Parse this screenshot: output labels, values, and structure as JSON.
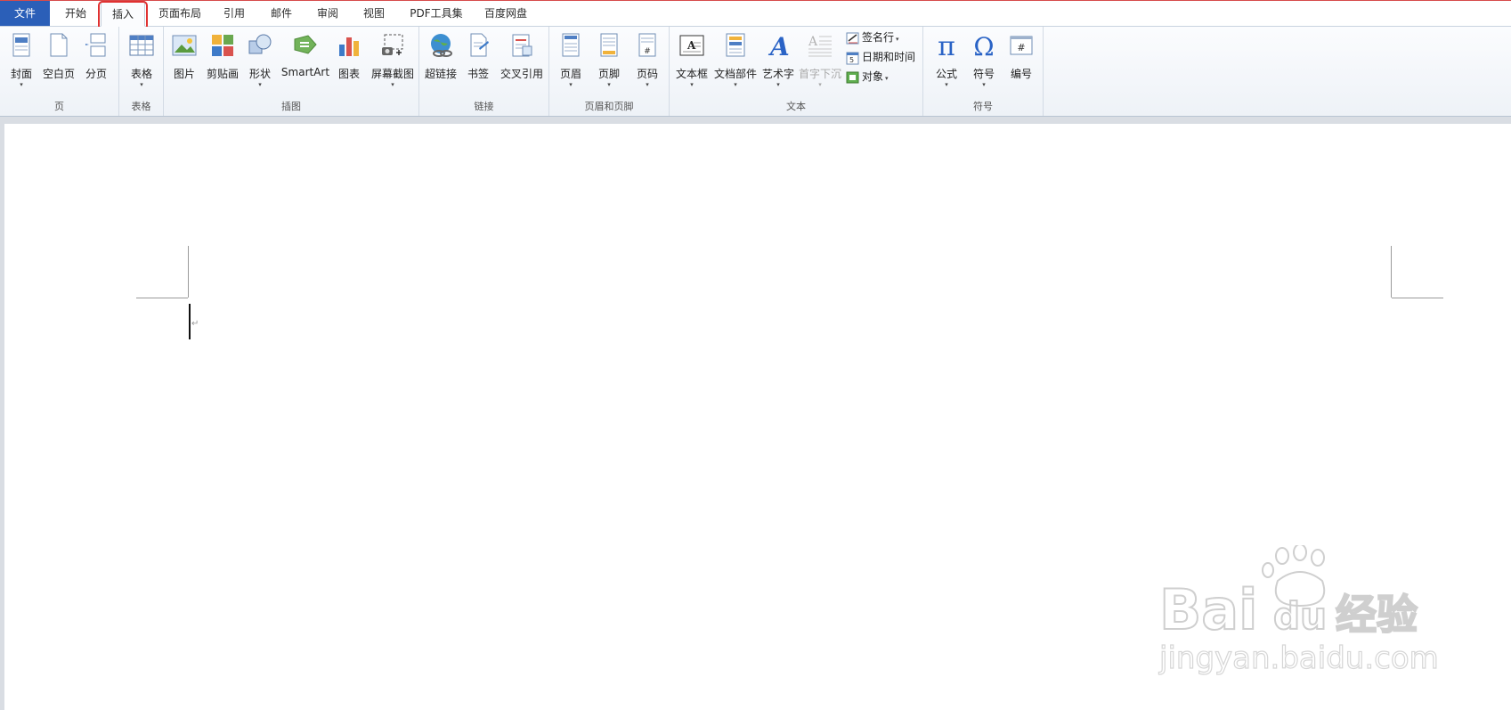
{
  "tabs": [
    "文件",
    "开始",
    "插入",
    "页面布局",
    "引用",
    "邮件",
    "审阅",
    "视图",
    "PDF工具集",
    "百度网盘"
  ],
  "groups": {
    "page": {
      "label": "页",
      "buttons": [
        "封面",
        "空白页",
        "分页"
      ]
    },
    "table": {
      "label": "表格",
      "buttons": [
        "表格"
      ]
    },
    "illustrations": {
      "label": "插图",
      "buttons": [
        "图片",
        "剪贴画",
        "形状",
        "SmartArt",
        "图表",
        "屏幕截图"
      ]
    },
    "links": {
      "label": "链接",
      "buttons": [
        "超链接",
        "书签",
        "交叉引用"
      ]
    },
    "header_footer": {
      "label": "页眉和页脚",
      "buttons": [
        "页眉",
        "页脚",
        "页码"
      ]
    },
    "text": {
      "label": "文本",
      "buttons": [
        "文本框",
        "文档部件",
        "艺术字",
        "首字下沉"
      ],
      "small": [
        "签名行",
        "日期和时间",
        "对象"
      ]
    },
    "symbols": {
      "label": "符号",
      "buttons": [
        "公式",
        "符号",
        "编号"
      ]
    }
  },
  "dropdown_arrow": "▾",
  "paragraph_mark": "↵",
  "watermark": {
    "brand": "Bai",
    "brand2": "du",
    "cn": "经验",
    "url": "jingyan.baidu.com"
  },
  "colors": {
    "file_tab": "#2b5fb8",
    "highlight": "#e03131",
    "accent_blue": "#2a63c6"
  }
}
